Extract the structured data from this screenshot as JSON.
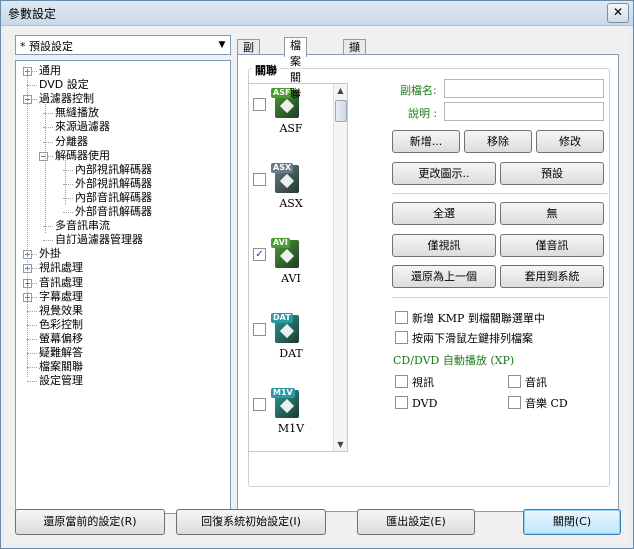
{
  "window": {
    "title": "參數設定",
    "close_glyph": "✕"
  },
  "preset": {
    "value": "* 預設設定"
  },
  "tree": {
    "items": [
      {
        "label": "通用",
        "expander": "+"
      },
      {
        "label": "DVD 設定",
        "expander": ""
      },
      {
        "label": "過濾器控制",
        "expander": "−"
      },
      {
        "label": "無縫播放",
        "expander": ""
      },
      {
        "label": "來源過濾器",
        "expander": ""
      },
      {
        "label": "分離器",
        "expander": ""
      },
      {
        "label": "解碼器使用",
        "expander": "−"
      },
      {
        "label": "內部視訊解碼器",
        "expander": ""
      },
      {
        "label": "外部視訊解碼器",
        "expander": ""
      },
      {
        "label": "內部音訊解碼器",
        "expander": ""
      },
      {
        "label": "外部音訊解碼器",
        "expander": ""
      },
      {
        "label": "多音訊串流",
        "expander": ""
      },
      {
        "label": "自訂過濾器管理器",
        "expander": ""
      },
      {
        "label": "外掛",
        "expander": "+"
      },
      {
        "label": "視訊處理",
        "expander": "+"
      },
      {
        "label": "音訊處理",
        "expander": "+"
      },
      {
        "label": "字幕處理",
        "expander": "+"
      },
      {
        "label": "視覺效果",
        "expander": ""
      },
      {
        "label": "色彩控制",
        "expander": ""
      },
      {
        "label": "螢幕偏移",
        "expander": ""
      },
      {
        "label": "疑難解答",
        "expander": ""
      },
      {
        "label": "檔案關聯",
        "expander": ""
      },
      {
        "label": "設定管理",
        "expander": ""
      }
    ]
  },
  "tabs": [
    {
      "label": "副檔名",
      "active": false
    },
    {
      "label": "檔案關聯",
      "active": true
    },
    {
      "label": "擷取",
      "active": false
    }
  ],
  "association": {
    "group_label": "關聯",
    "files": [
      {
        "label": "ASF",
        "checked": false,
        "color": "#4a9d2f"
      },
      {
        "label": "ASX",
        "checked": false,
        "color": "#6b7c86"
      },
      {
        "label": "AVI",
        "checked": true,
        "color": "#4a9d2f",
        "check_glyph": "✓"
      },
      {
        "label": "DAT",
        "checked": false,
        "color": "#2a9aa0"
      },
      {
        "label": "M1V",
        "checked": false,
        "color": "#2a9aa0"
      }
    ],
    "ext_label": "副檔名:",
    "ext_value": "",
    "desc_label": "說明 :",
    "desc_value": ""
  },
  "buttons": {
    "add": "新增...",
    "remove": "移除",
    "modify": "修改",
    "change_icon": "更改圖示..",
    "default": "預設",
    "select_all": "全選",
    "none": "無",
    "video_only": "僅視訊",
    "audio_only": "僅音訊",
    "restore_prev": "還原為上一個",
    "apply_system": "套用到系統"
  },
  "options": {
    "add_kmp_menu": "新增 KMP 到檔關聯選單中",
    "enqueue_left_click": "按兩下滑鼠左鍵排列檔案",
    "autoplay_title": "CD/DVD 自動播放 (XP)",
    "video": "視訊",
    "audio": "音訊",
    "dvd": "DVD",
    "music_cd": "音樂 CD"
  },
  "footer": {
    "restore_current": "還原當前的設定(R)",
    "reset_system": "回復系統初始設定(I)",
    "export": "匯出設定(E)",
    "close": "關閉(C)"
  },
  "scroll": {
    "up": "▲",
    "down": "▼"
  }
}
